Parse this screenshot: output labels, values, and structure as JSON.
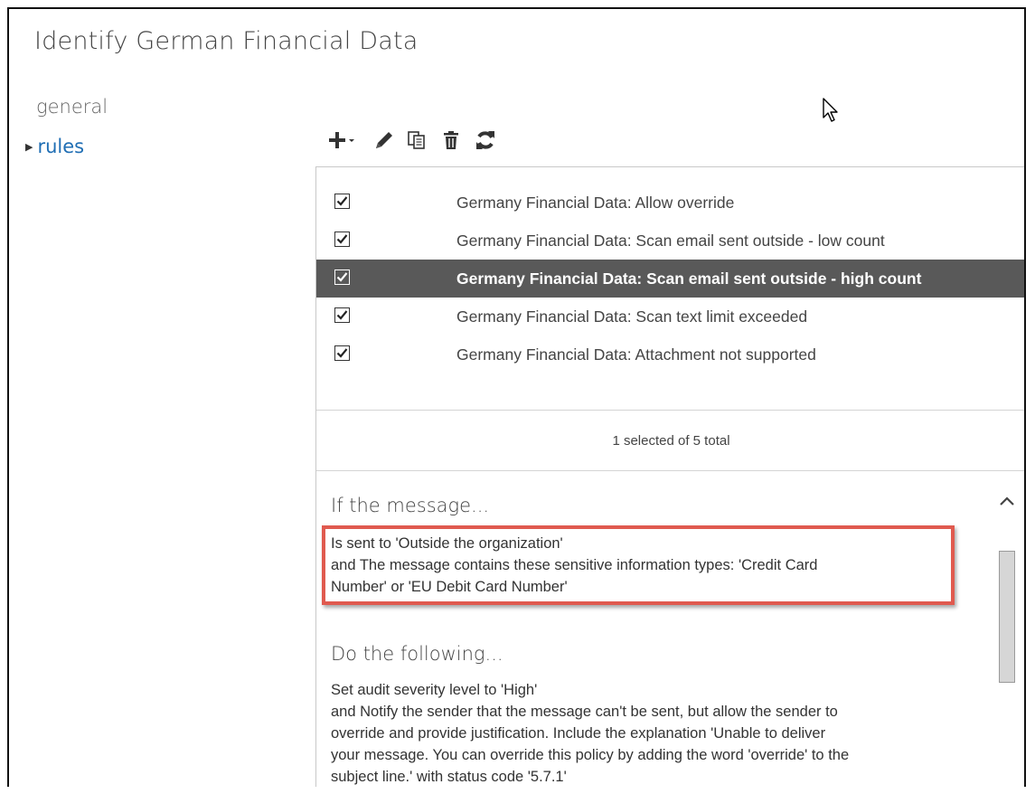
{
  "title": "Identify German Financial Data",
  "nav": {
    "general": "general",
    "rules": "rules"
  },
  "toolbar": {
    "add": "add-icon",
    "edit": "pencil-icon",
    "copy": "copy-icon",
    "delete": "trash-icon",
    "refresh": "refresh-icon"
  },
  "rules": [
    {
      "label": "Germany Financial Data: Allow override",
      "checked": true,
      "selected": false
    },
    {
      "label": "Germany Financial Data: Scan email sent outside - low count",
      "checked": true,
      "selected": false
    },
    {
      "label": "Germany Financial Data: Scan email sent outside - high count",
      "checked": true,
      "selected": true
    },
    {
      "label": "Germany Financial Data: Scan text limit exceeded",
      "checked": true,
      "selected": false
    },
    {
      "label": "Germany Financial Data: Attachment not supported",
      "checked": true,
      "selected": false
    }
  ],
  "status": "1 selected of 5 total",
  "details": {
    "condition_heading": "If the message...",
    "condition_lines": [
      "Is sent to 'Outside the organization'",
      "and The message contains these sensitive information types: 'Credit Card",
      "Number' or 'EU Debit Card Number'"
    ],
    "action_heading": "Do the following...",
    "action_lines": [
      "Set audit severity level to 'High'",
      "and Notify the sender that the message can't be sent, but allow the sender to",
      "override and provide justification. Include the explanation 'Unable to deliver",
      "your message. You can override this policy by adding the word 'override' to the",
      "subject line.' with status code '5.7.1'"
    ]
  },
  "colors": {
    "link": "#1f6eb4",
    "selected_row": "#595959",
    "highlight_border": "#e05a4f"
  }
}
